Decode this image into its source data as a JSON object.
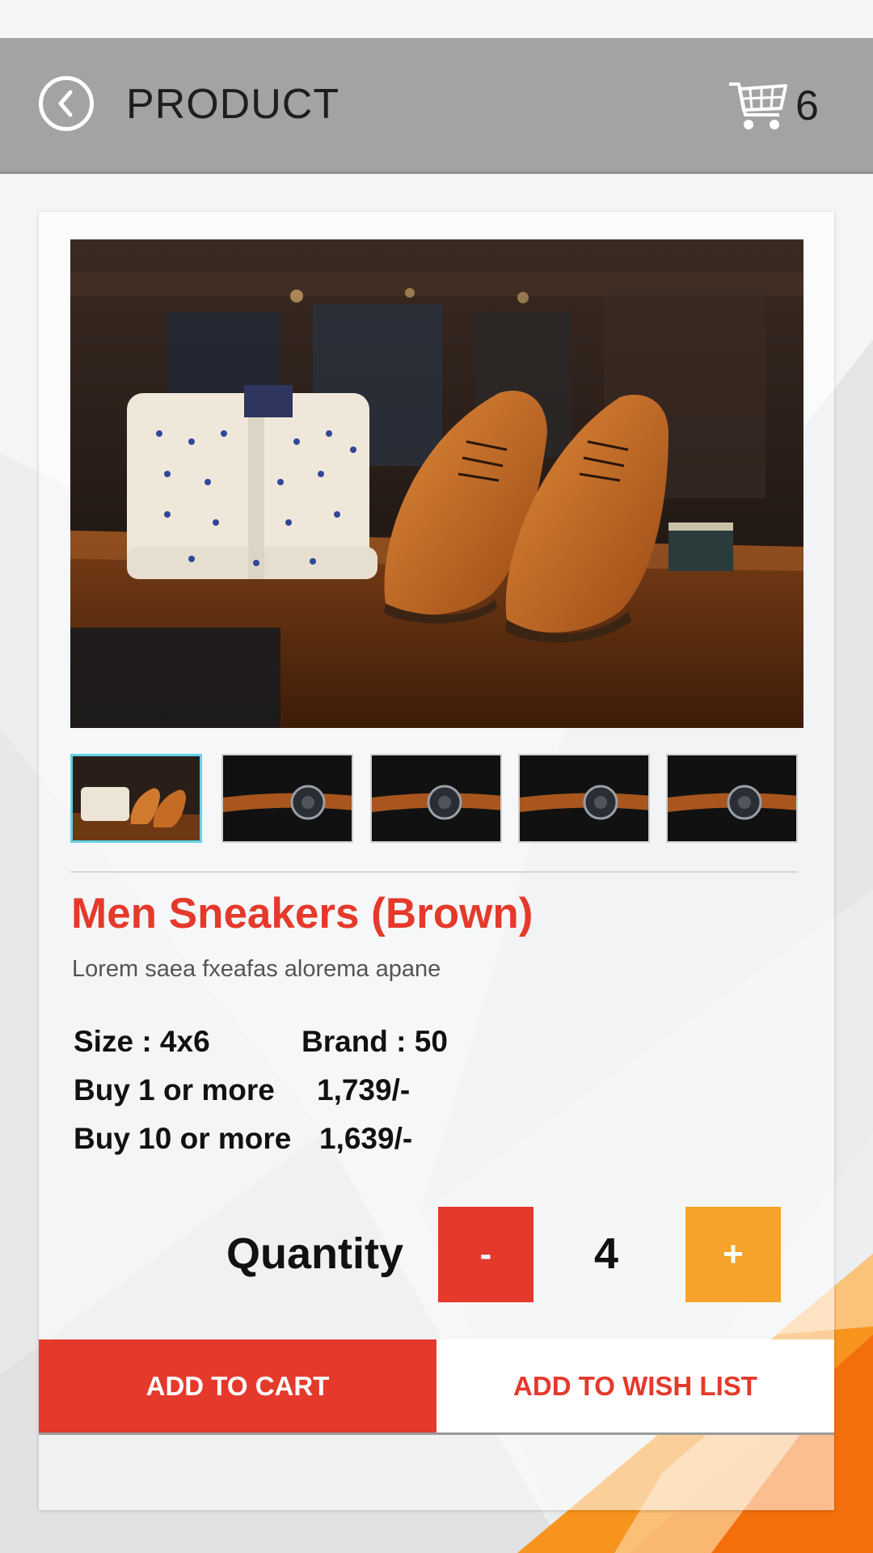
{
  "header": {
    "title": "PRODUCT",
    "cart_count": "6"
  },
  "icons": {
    "back": "chevron-left-circle",
    "cart": "shopping-cart"
  },
  "product": {
    "name": "Men Sneakers (Brown)",
    "description": "Lorem saea fxeafas alorema apane",
    "size": "Size : 4x6",
    "brand": "Brand : 50",
    "tier1_label": "Buy 1 or more",
    "tier1_price": "1,739/-",
    "tier10_label": "Buy 10 or more",
    "tier10_price": "1,639/-"
  },
  "quantity": {
    "label": "Quantity",
    "minus": "-",
    "value": "4",
    "plus": "+"
  },
  "actions": {
    "add_to_cart": "ADD TO CART",
    "add_to_wish_list": "ADD TO WISH LIST"
  },
  "colors": {
    "accent_red": "#e5392b",
    "accent_orange": "#f5a32a",
    "app_bar": "#a3a3a3",
    "thumb_active_border": "#5fd3e6"
  }
}
